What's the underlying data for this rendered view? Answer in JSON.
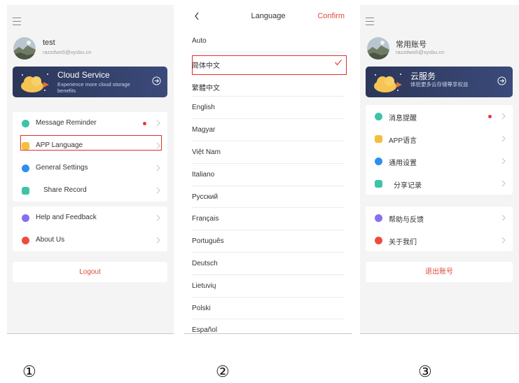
{
  "panel1": {
    "user": {
      "name": "test",
      "email": "razzdwo5@xysbu.cn"
    },
    "cloud": {
      "title": "Cloud Service",
      "subtitle": "Experience more cloud storage benefits"
    },
    "menu": [
      {
        "label": "Message Reminder",
        "icon": "message-icon",
        "color": "#3ec3a7"
      },
      {
        "label": "APP Language",
        "icon": "language-icon",
        "color": "#f5bf3b"
      },
      {
        "label": "General Settings",
        "icon": "settings-icon",
        "color": "#2d8ff0"
      },
      {
        "label": "Share Record",
        "icon": "share-icon",
        "color": "#3ec3a7"
      }
    ],
    "menu2": [
      {
        "label": "Help and Feedback",
        "icon": "help-icon",
        "color": "#8a6ef0"
      },
      {
        "label": "About Us",
        "icon": "info-icon",
        "color": "#ee4b3f"
      }
    ],
    "logout": "Logout"
  },
  "panel2": {
    "title": "Language",
    "confirm": "Confirm",
    "languages": [
      "Auto",
      "简体中文",
      "繁體中文",
      "English",
      "Magyar",
      "Việt Nam",
      "Italiano",
      "Русский",
      "Français",
      "Português",
      "Deutsch",
      "Lietuvių",
      "Polski",
      "Español"
    ],
    "selected": "简体中文"
  },
  "panel3": {
    "user": {
      "name": "常用账号",
      "email": "razzdwo5@xysbu.cn"
    },
    "cloud": {
      "title": "云服务",
      "subtitle": "体验更多云存储尊享权益"
    },
    "menu": [
      {
        "label": "消息提醒",
        "icon": "message-icon",
        "color": "#3ec3a7"
      },
      {
        "label": "APP语言",
        "icon": "language-icon",
        "color": "#f5bf3b"
      },
      {
        "label": "通用设置",
        "icon": "settings-icon",
        "color": "#2d8ff0"
      },
      {
        "label": "分享记录",
        "icon": "share-icon",
        "color": "#3ec3a7"
      }
    ],
    "menu2": [
      {
        "label": "帮助与反馈",
        "icon": "help-icon",
        "color": "#8a6ef0"
      },
      {
        "label": "关于我们",
        "icon": "info-icon",
        "color": "#ee4b3f"
      }
    ],
    "logout": "退出账号"
  },
  "step_labels": [
    "①",
    "②",
    "③"
  ],
  "colors": {
    "accent": "#e0493d",
    "card": "#2f3b62",
    "highlight": "#e02e2e",
    "badge": "#e8373b"
  }
}
